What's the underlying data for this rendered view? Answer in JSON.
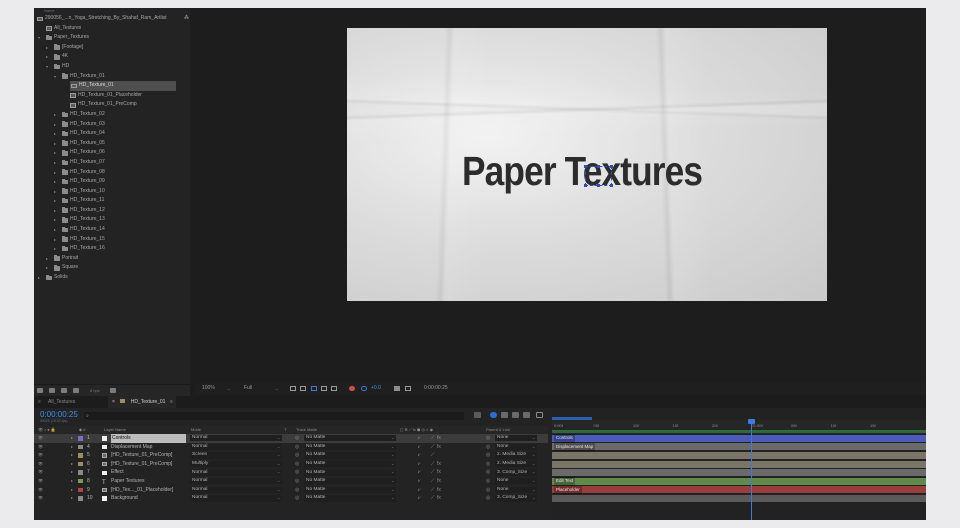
{
  "project": {
    "header_label": "Name",
    "root_item": "290056_...n_Yoga_Stretching_By_Shahaf_Ram_Artlist",
    "items": [
      {
        "label": "All_Textures",
        "kind": "comp",
        "depth": 0,
        "arrow": ""
      },
      {
        "label": "Paper_Textures",
        "kind": "folder",
        "depth": 0,
        "arrow": "▾"
      },
      {
        "label": "[Footage]",
        "kind": "folder",
        "depth": 1,
        "arrow": "▸"
      },
      {
        "label": "4K",
        "kind": "folder",
        "depth": 1,
        "arrow": "▸"
      },
      {
        "label": "HD",
        "kind": "folder",
        "depth": 1,
        "arrow": "▾"
      },
      {
        "label": "HD_Texture_01",
        "kind": "folder",
        "depth": 2,
        "arrow": "▾"
      },
      {
        "label": "HD_Texture_01",
        "kind": "comp",
        "depth": 3,
        "arrow": "",
        "selected": true
      },
      {
        "label": "HD_Texture_01_Placeholder",
        "kind": "comp",
        "depth": 3,
        "arrow": ""
      },
      {
        "label": "HD_Texture_01_PreComp",
        "kind": "comp",
        "depth": 3,
        "arrow": ""
      },
      {
        "label": "HD_Texture_02",
        "kind": "folder",
        "depth": 2,
        "arrow": "▸"
      },
      {
        "label": "HD_Texture_03",
        "kind": "folder",
        "depth": 2,
        "arrow": "▸"
      },
      {
        "label": "HD_Texture_04",
        "kind": "folder",
        "depth": 2,
        "arrow": "▸"
      },
      {
        "label": "HD_Texture_05",
        "kind": "folder",
        "depth": 2,
        "arrow": "▸"
      },
      {
        "label": "HD_Texture_06",
        "kind": "folder",
        "depth": 2,
        "arrow": "▸"
      },
      {
        "label": "HD_Texture_07",
        "kind": "folder",
        "depth": 2,
        "arrow": "▸"
      },
      {
        "label": "HD_Texture_08",
        "kind": "folder",
        "depth": 2,
        "arrow": "▸"
      },
      {
        "label": "HD_Texture_09",
        "kind": "folder",
        "depth": 2,
        "arrow": "▸"
      },
      {
        "label": "HD_Texture_10",
        "kind": "folder",
        "depth": 2,
        "arrow": "▸"
      },
      {
        "label": "HD_Texture_11",
        "kind": "folder",
        "depth": 2,
        "arrow": "▸"
      },
      {
        "label": "HD_Texture_12",
        "kind": "folder",
        "depth": 2,
        "arrow": "▸"
      },
      {
        "label": "HD_Texture_13",
        "kind": "folder",
        "depth": 2,
        "arrow": "▸"
      },
      {
        "label": "HD_Texture_14",
        "kind": "folder",
        "depth": 2,
        "arrow": "▸"
      },
      {
        "label": "HD_Texture_15",
        "kind": "folder",
        "depth": 2,
        "arrow": "▸"
      },
      {
        "label": "HD_Texture_16",
        "kind": "folder",
        "depth": 2,
        "arrow": "▸"
      },
      {
        "label": "Portrait",
        "kind": "folder",
        "depth": 1,
        "arrow": "▸"
      },
      {
        "label": "Square",
        "kind": "folder",
        "depth": 1,
        "arrow": "▸"
      },
      {
        "label": "Solids",
        "kind": "folder",
        "depth": 0,
        "arrow": "▸"
      }
    ],
    "footer_bpc": "8 bpc"
  },
  "viewer": {
    "comp_text": "Paper Textures",
    "zoom": "100%",
    "resolution": "Full",
    "exposure": "+0.0",
    "timecode": "0:00:00:25"
  },
  "timeline": {
    "tabs": [
      {
        "label": "All_Textures",
        "active": false
      },
      {
        "label": "HD_Texture_01",
        "active": true
      }
    ],
    "current_time": "0:00:00:25",
    "fps_note": "00025 (25.00 fps)",
    "columns": {
      "layer_name": "Layer Name",
      "mode": "Mode",
      "t": "T",
      "track_matte": "Track Matte",
      "parent_link": "Parent & Link"
    },
    "layers": [
      {
        "num": "1",
        "name": "Controls",
        "mode": "Normal",
        "matte": "No Matte",
        "parent": "None",
        "color": "#7c6cc7",
        "type": "solid",
        "selected": true,
        "bar_color": "#4a5bb8",
        "bar_label": "Controls"
      },
      {
        "num": "4",
        "name": "Displacement Map",
        "mode": "Normal",
        "matte": "No Matte",
        "parent": "None",
        "color": "#8a8a8a",
        "type": "solid",
        "bar_color": "#6a6a6a",
        "bar_label": "Displacement Map"
      },
      {
        "num": "5",
        "name": "[HD_Texture_01_PreComp]",
        "mode": "Screen",
        "matte": "No Matte",
        "parent": "2. Media Size",
        "color": "#9e8d5f",
        "type": "comp",
        "bar_color": "#7a7566",
        "bar_label": ""
      },
      {
        "num": "6",
        "name": "[HD_Texture_01_PreComp]",
        "mode": "Multiply",
        "matte": "No Matte",
        "parent": "2. Media Size",
        "color": "#9e8d5f",
        "type": "comp",
        "bar_color": "#7a7566",
        "bar_label": ""
      },
      {
        "num": "7",
        "name": "Effect",
        "mode": "Normal",
        "matte": "No Matte",
        "parent": "3. Comp_Size",
        "color": "#8a8a8a",
        "type": "solid",
        "bar_color": "#6a6a6a",
        "bar_label": ""
      },
      {
        "num": "8",
        "name": "Paper Textures",
        "mode": "Normal",
        "matte": "No Matte",
        "parent": "None",
        "color": "#7f9a4e",
        "type": "text",
        "bar_color": "#5f8a4a",
        "bar_label": "Edit Text"
      },
      {
        "num": "9",
        "name": "[HD_Tex..._01_Placeholder]",
        "mode": "Normal",
        "matte": "No Matte",
        "parent": "None",
        "color": "#b04444",
        "type": "comp",
        "bar_color": "#9a3d3d",
        "bar_label": "Placeholder"
      },
      {
        "num": "10",
        "name": "Background",
        "mode": "Normal",
        "matte": "No Matte",
        "parent": "3. Comp_Size",
        "color": "#8a8a8a",
        "type": "solid",
        "bar_color": "#5a5a5a",
        "bar_label": ""
      }
    ],
    "ruler_ticks": [
      "0:00f",
      "05f",
      "10f",
      "15f",
      "20f",
      "01:00f",
      "05f",
      "10f",
      "15f"
    ]
  }
}
